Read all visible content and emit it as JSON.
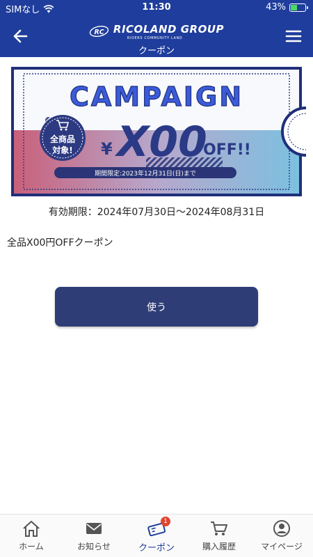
{
  "status_bar": {
    "carrier": "SIMなし",
    "time": "11:30",
    "battery": "43%",
    "battery_level": 0.43
  },
  "header": {
    "logo_main": "RICOLAND GROUP",
    "logo_sub": "RIDERS COMMUNITY LAND",
    "logo_mark": "RC",
    "title": "クーポン"
  },
  "banner": {
    "headline": "CAMPAIGN",
    "badge_line1": "全商品",
    "badge_line2": "対象!",
    "yen_sign": "¥",
    "amount": "X00",
    "off": "OFF!!",
    "period": "期間限定:2023年12月31日(日)まで"
  },
  "coupon": {
    "validity": "有効期限：2024年07月30日～2024年08月31日",
    "description": "全品X00円OFFクーポン",
    "use_label": "使う"
  },
  "nav": {
    "items": [
      {
        "label": "ホーム",
        "icon": "home-icon"
      },
      {
        "label": "お知らせ",
        "icon": "mail-icon"
      },
      {
        "label": "クーポン",
        "icon": "coupon-icon",
        "badge": "1",
        "active": true
      },
      {
        "label": "購入履歴",
        "icon": "cart-icon"
      },
      {
        "label": "マイページ",
        "icon": "user-icon"
      }
    ]
  },
  "colors": {
    "primary": "#1f3d9c",
    "button": "#2f3d77",
    "badge": "#e0452f"
  }
}
